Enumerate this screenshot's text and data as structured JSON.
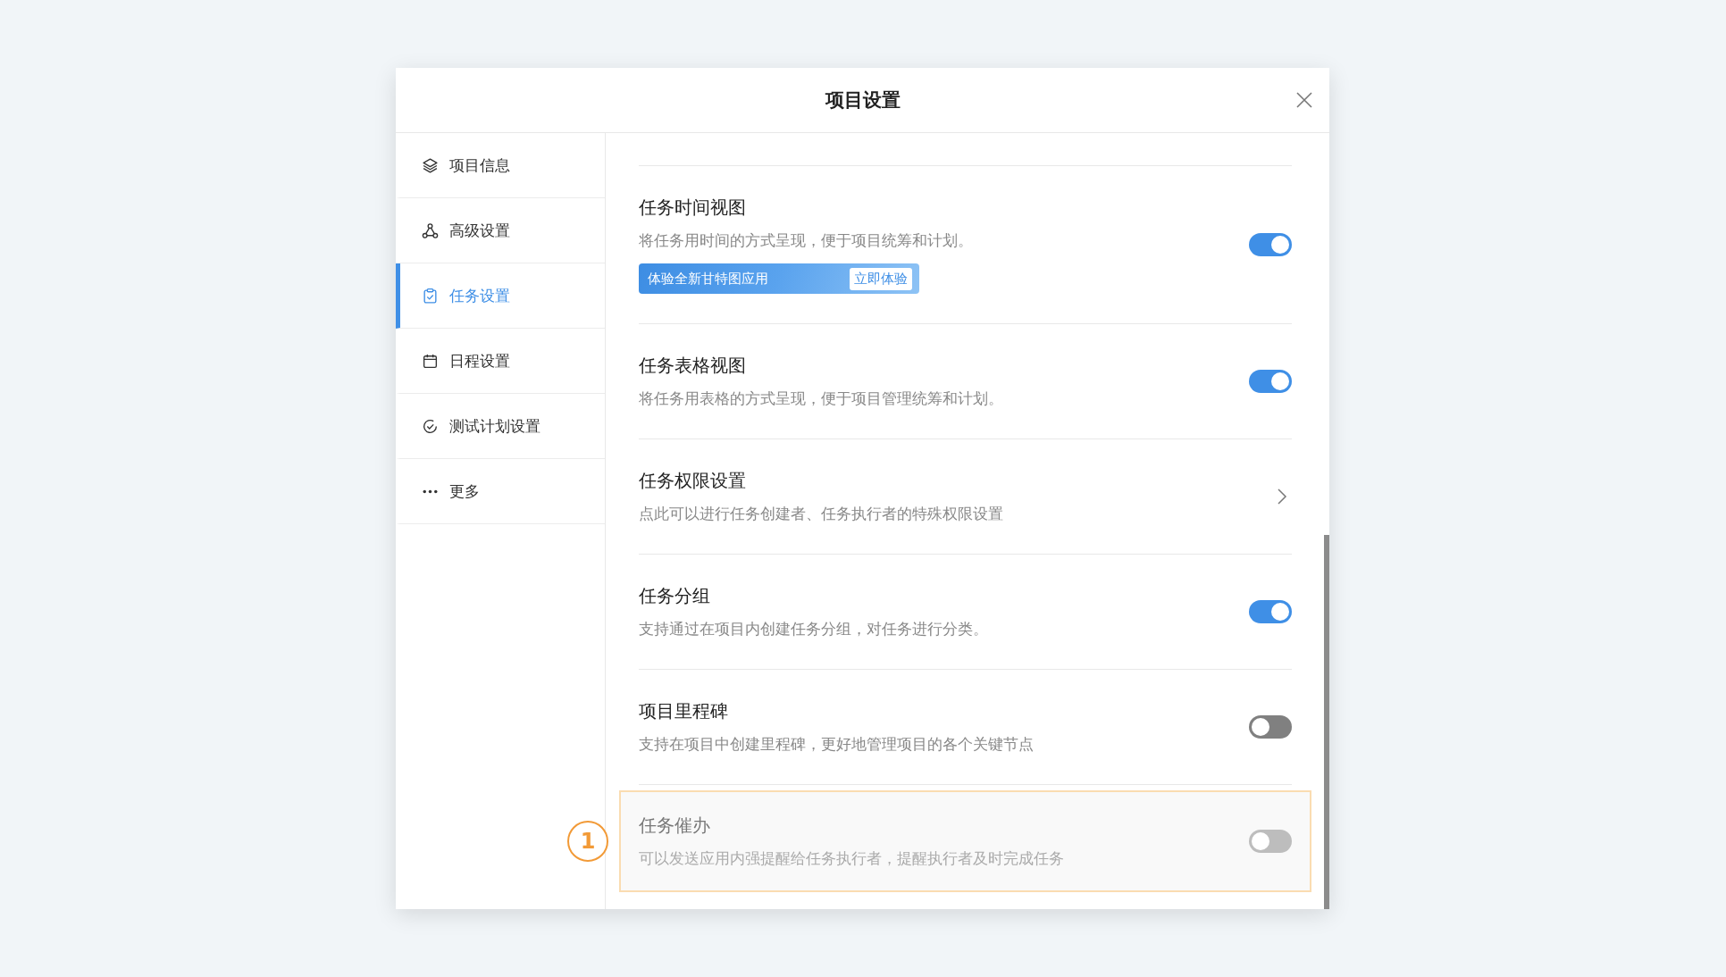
{
  "dialog": {
    "title": "项目设置"
  },
  "sidebar": {
    "items": [
      {
        "label": "项目信息",
        "kind": "layers",
        "selected": false
      },
      {
        "label": "高级设置",
        "kind": "nodes",
        "selected": false
      },
      {
        "label": "任务设置",
        "kind": "clipboard",
        "selected": true
      },
      {
        "label": "日程设置",
        "kind": "calendar",
        "selected": false
      },
      {
        "label": "测试计划设置",
        "kind": "check",
        "selected": false
      },
      {
        "label": "更多",
        "kind": "more",
        "selected": false
      }
    ]
  },
  "settings": [
    {
      "kind": "toggle",
      "title": "任务时间视图",
      "description": "将任务用时间的方式呈现，便于项目统筹和计划。",
      "on": true,
      "disabled": false,
      "highlighted": false,
      "promo": {
        "text": "体验全新甘特图应用",
        "button": "立即体验"
      }
    },
    {
      "kind": "toggle",
      "title": "任务表格视图",
      "description": "将任务用表格的方式呈现，便于项目管理统筹和计划。",
      "on": true,
      "disabled": false,
      "highlighted": false
    },
    {
      "kind": "link",
      "title": "任务权限设置",
      "description": "点此可以进行任务创建者、任务执行者的特殊权限设置",
      "highlighted": false
    },
    {
      "kind": "toggle",
      "title": "任务分组",
      "description": "支持通过在项目内创建任务分组，对任务进行分类。",
      "on": true,
      "disabled": false,
      "highlighted": false
    },
    {
      "kind": "toggle",
      "title": "项目里程碑",
      "description": "支持在项目中创建里程碑，更好地管理项目的各个关键节点",
      "on": false,
      "disabled": false,
      "highlighted": false
    },
    {
      "kind": "toggle",
      "title": "任务催办",
      "description": "可以发送应用内强提醒给任务执行者，提醒执行者及时完成任务",
      "on": false,
      "disabled": true,
      "highlighted": true,
      "callout": "1"
    }
  ]
}
